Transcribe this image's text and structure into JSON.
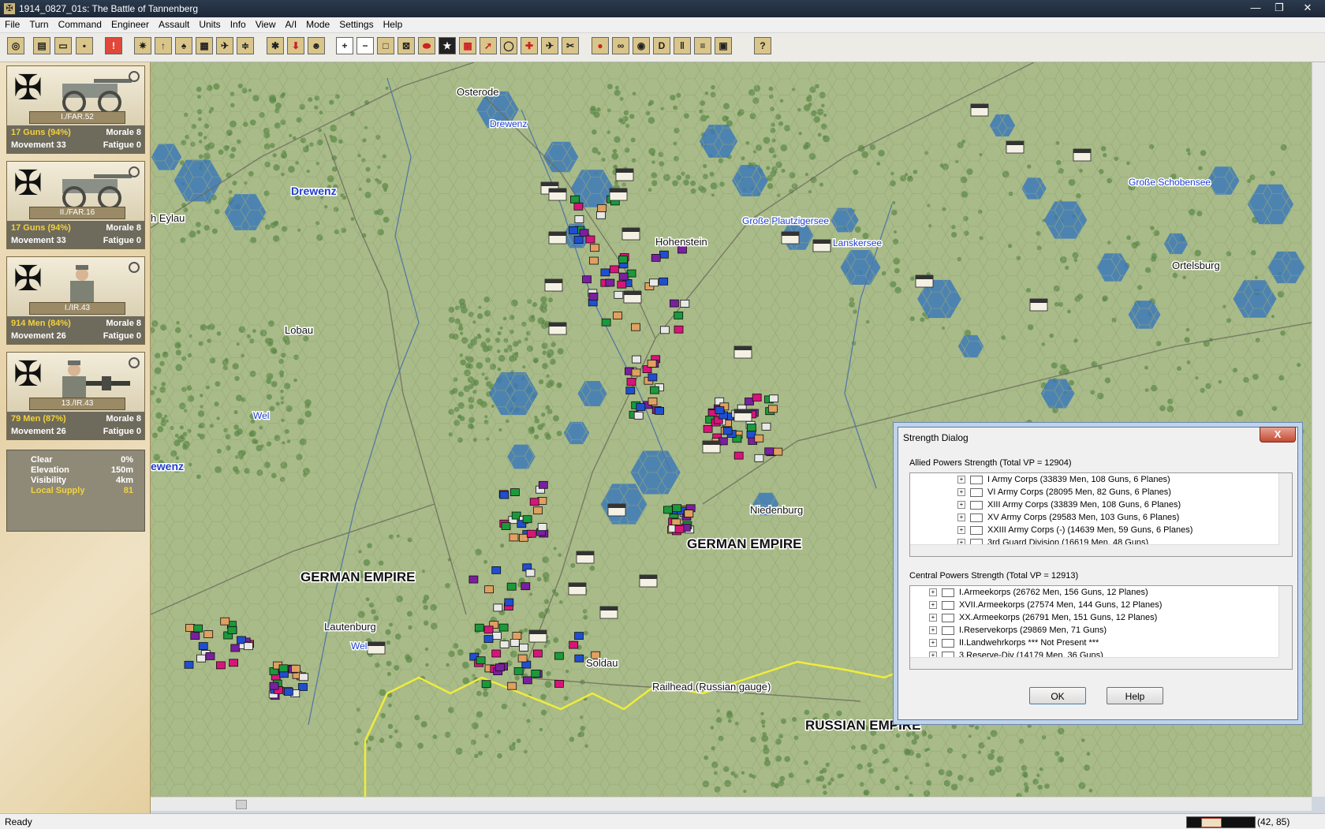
{
  "window": {
    "title": "1914_0827_01s: The Battle of Tannenberg",
    "minimize": "—",
    "maximize": "❐",
    "close": "✕"
  },
  "menu": [
    "File",
    "Turn",
    "Command",
    "Engineer",
    "Assault",
    "Units",
    "Info",
    "View",
    "A/I",
    "Mode",
    "Settings",
    "Help"
  ],
  "units": [
    {
      "name": "I./FAR.52",
      "strength": "17 Guns (94%)",
      "morale": "Morale 8",
      "movement": "Movement 33",
      "fatigue": "Fatigue 0",
      "type": "artillery"
    },
    {
      "name": "II./FAR.16",
      "strength": "17 Guns (94%)",
      "morale": "Morale 8",
      "movement": "Movement 33",
      "fatigue": "Fatigue 0",
      "type": "artillery"
    },
    {
      "name": "I./IR.43",
      "strength": "914 Men (84%)",
      "morale": "Morale 8",
      "movement": "Movement 26",
      "fatigue": "Fatigue 0",
      "type": "infantry"
    },
    {
      "name": "13./IR.43",
      "strength": "79 Men (87%)",
      "morale": "Morale 8",
      "movement": "Movement 26",
      "fatigue": "Fatigue 0",
      "type": "machinegun"
    }
  ],
  "terrain": [
    {
      "label": "Clear",
      "value": "0%"
    },
    {
      "label": "Elevation",
      "value": "150m"
    },
    {
      "label": "Visibility",
      "value": "4km"
    },
    {
      "label": "Local Supply",
      "value": "81"
    }
  ],
  "map_labels": [
    {
      "text": "Osterode",
      "cls": "town"
    },
    {
      "text": "Drewenz",
      "cls": "river"
    },
    {
      "text": "Drewenz",
      "cls": "riverbig"
    },
    {
      "text": "h Eylau",
      "cls": "town"
    },
    {
      "text": "Lobau",
      "cls": "town"
    },
    {
      "text": "Wel",
      "cls": "river"
    },
    {
      "text": "ewenz",
      "cls": "riverbig"
    },
    {
      "text": "Hohenstein",
      "cls": "town"
    },
    {
      "text": "Große Plautzigersee",
      "cls": "river"
    },
    {
      "text": "Lanskersee",
      "cls": "river"
    },
    {
      "text": "Große Schobensee",
      "cls": "river"
    },
    {
      "text": "Ortelsburg",
      "cls": "town"
    },
    {
      "text": "Niedenburg",
      "cls": "town"
    },
    {
      "text": "GERMAN EMPIRE",
      "cls": "country"
    },
    {
      "text": "GERMAN EMPIRE",
      "cls": "country"
    },
    {
      "text": "Lautenburg",
      "cls": "town"
    },
    {
      "text": "Wel",
      "cls": "river"
    },
    {
      "text": "Soldau",
      "cls": "town"
    },
    {
      "text": "Railhead (Russian gauge)",
      "cls": "town"
    },
    {
      "text": "RUSSIAN EMPIRE",
      "cls": "country"
    }
  ],
  "dialog": {
    "title": "Strength Dialog",
    "close": "X",
    "allied_label": "Allied Powers Strength (Total VP = 12904)",
    "allied_items": [
      "I Army Corps (33839 Men, 108 Guns, 6 Planes)",
      "VI Army Corps (28095 Men, 82 Guns, 6 Planes)",
      "XIII Army Corps (33839 Men, 108 Guns, 6 Planes)",
      "XV Army Corps (29583 Men, 103 Guns, 6 Planes)",
      "XXIII Army Corps (-) (14639 Men, 59 Guns, 6 Planes)",
      "3rd Guard Division (16619 Men, 48 Guns)"
    ],
    "central_label": "Central Powers Strength (Total VP = 12913)",
    "central_items": [
      "I.Armeekorps (26762 Men, 156 Guns, 12 Planes)",
      "XVII.Armeekorps (27574 Men, 144 Guns, 12 Planes)",
      "XX.Armeekorps (26791 Men, 151 Guns, 12 Planes)",
      "I.Reservekorps (29869 Men, 71 Guns)",
      "II.Landwehrkorps  *** Not Present ***",
      "3.Reserve-Div (14179 Men, 36 Guns)"
    ],
    "ok": "OK",
    "help": "Help"
  },
  "status": {
    "text": "Ready",
    "coords": "(42, 85)"
  },
  "colors": {
    "terrain": "#a9bb88",
    "water": "#3d79b8",
    "forest": "#5f8a4a",
    "border": "#f0ec3c"
  }
}
